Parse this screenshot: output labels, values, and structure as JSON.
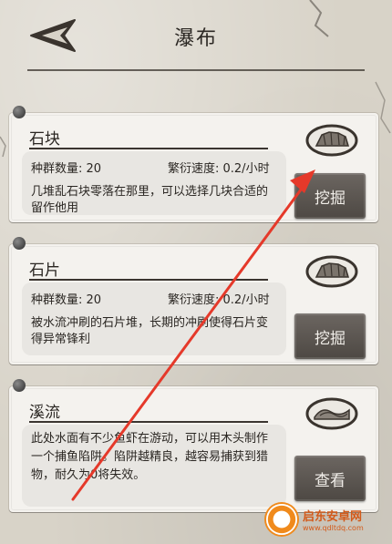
{
  "header": {
    "title": "瀑布"
  },
  "cards": [
    {
      "name": "石块",
      "population": "种群数量: 20",
      "breed_rate": "繁衍速度: 0.2/小时",
      "description": "几堆乱石块零落在那里，可以选择几块合适的留作他用",
      "action": "挖掘",
      "icon": "rock-pile-icon"
    },
    {
      "name": "石片",
      "population": "种群数量: 20",
      "breed_rate": "繁衍速度: 0.2/小时",
      "description": "被水流冲刷的石片堆，长期的冲刷使得石片变得异常锋利",
      "action": "挖掘",
      "icon": "rock-pile-icon"
    },
    {
      "name": "溪流",
      "description": "此处水面有不少鱼虾在游动，可以用木头制作一个捕鱼陷阱。陷阱越精良，越容易捕获到猎物，耐久为0将失效。",
      "action": "查看",
      "icon": "stream-icon"
    }
  ],
  "watermark": {
    "name": "启东安卓网",
    "url": "www.qdltdq.com"
  },
  "colors": {
    "annotation_arrow": "#e5392a",
    "button": "#5b5550",
    "card": "#f4f2ee",
    "background": "#d8d3c8"
  }
}
